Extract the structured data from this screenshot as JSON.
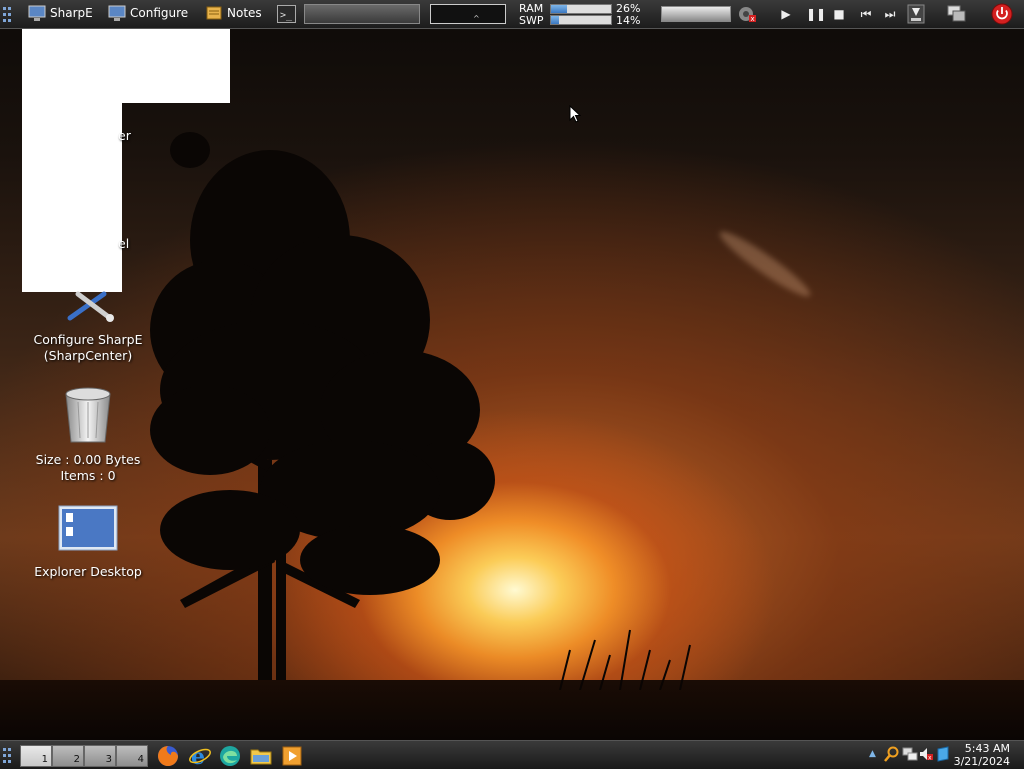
{
  "topbar": {
    "menu_sharpe": "SharpE",
    "menu_configure": "Configure",
    "menu_notes": "Notes",
    "ram_label": "RAM",
    "swp_label": "SWP",
    "ram_percent": "26%",
    "swp_percent": "14%",
    "ram_fraction": 0.26,
    "swp_fraction": 0.14
  },
  "desktop": {
    "icon_partial_1": "er",
    "icon_partial_2": "el",
    "configure_sharpe_line1": "Configure SharpE",
    "configure_sharpe_line2": "(SharpCenter)",
    "recycle_size": "Size : 0.00 Bytes",
    "recycle_items": "Items : 0",
    "explorer_desktop": "Explorer Desktop"
  },
  "taskbar": {
    "workspaces": [
      "1",
      "2",
      "3",
      "4"
    ],
    "time": "5:43 AM",
    "date": "3/21/2024"
  },
  "colors": {
    "meter_fill": "#3b78c2",
    "power_red": "#d32020"
  }
}
